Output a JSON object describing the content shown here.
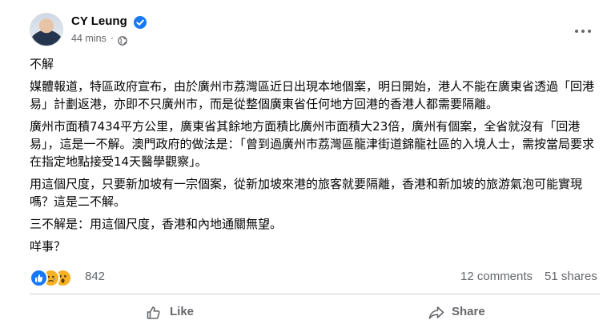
{
  "post": {
    "author": "CY Leung",
    "time": "44 mins",
    "dot": "·",
    "paragraphs": [
      "不解",
      "媒體報道，特區政府宣布，由於廣州市荔灣區近日出現本地個案，明日開始，港人不能在廣東省透過「回港易」計劃返港，亦即不只廣州市，而是從整個廣東省任何地方回港的香港人都需要隔離。",
      "廣州市面積7434平方公里，廣東省其餘地方面積比廣州市面積大23倍，廣州有個案，全省就沒有「回港易」，這是一不解。澳門政府的做法是：「曾到過廣州市荔灣區龍津街道錦龍社區的入境人士，需按當局要求在指定地點接受14天醫學觀察」。",
      "用這個尺度，只要新加坡有一宗個案，從新加坡來港的旅客就要隔離，香港和新加坡的旅游氣泡可能實現嗎？這是二不解。",
      "三不解是：用這個尺度，香港和內地通關無望。",
      "咩事？"
    ]
  },
  "stats": {
    "reactions_count": "842",
    "comments": "12 comments",
    "shares": "51 shares"
  },
  "actions": {
    "like_label": "Like",
    "share_label": "Share"
  },
  "colors": {
    "accent": "#1877f2",
    "secondary_text": "#65676b",
    "reaction_yellow": "#f7b125"
  },
  "icons": {
    "verified": "verified-badge-icon",
    "audience": "globe-icon",
    "more": "more-options-icon",
    "reactions": [
      "like-reaction-icon",
      "sad-reaction-icon",
      "wow-reaction-icon"
    ],
    "like": "thumbs-up-icon",
    "share": "share-arrow-icon"
  }
}
